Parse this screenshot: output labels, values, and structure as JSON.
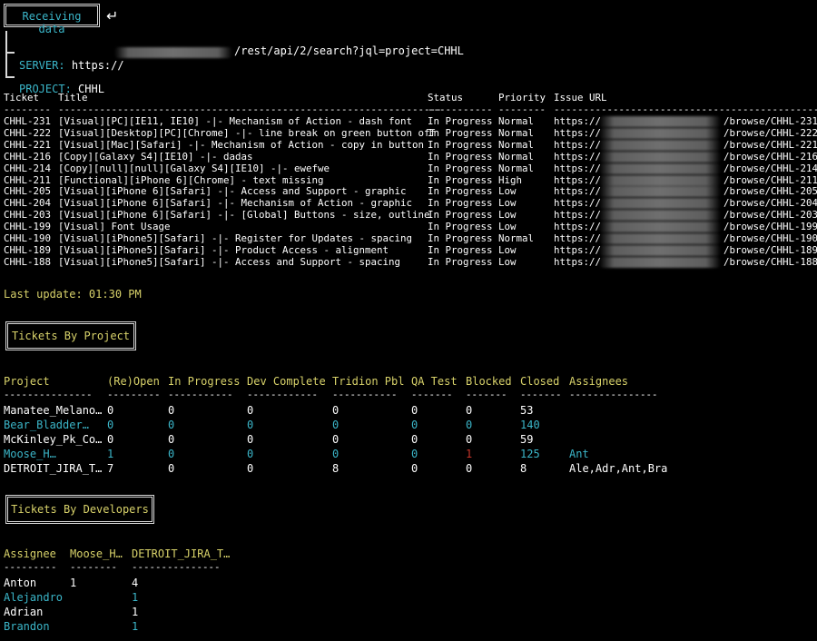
{
  "header": {
    "receiving_label": "Receiving data",
    "enter_glyph": "↵",
    "server_label": "SERVER:",
    "server_prefix": "https://",
    "server_suffix": "/rest/api/2/search?jql=project=CHHL",
    "project_label": "PROJECT:",
    "project_value": "CHHL"
  },
  "tickets_table": {
    "headers": [
      "Ticket",
      "Title",
      "Status",
      "Priority",
      "Issue URL"
    ],
    "url_prefix": "https://",
    "rows": [
      {
        "ticket": "CHHL-231",
        "title": "[Visual][PC][IE11, IE10] -|- Mechanism of Action - dash font",
        "status": "In Progress",
        "priority": "Normal",
        "url_suffix": "/browse/CHHL-231"
      },
      {
        "ticket": "CHHL-222",
        "title": "[Visual][Desktop][PC][Chrome] -|- line break on green button off",
        "status": "In Progress",
        "priority": "Normal",
        "url_suffix": "/browse/CHHL-222"
      },
      {
        "ticket": "CHHL-221",
        "title": "[Visual][Mac][Safari] -|- Mechanism of Action - copy in button",
        "status": "In Progress",
        "priority": "Normal",
        "url_suffix": "/browse/CHHL-221"
      },
      {
        "ticket": "CHHL-216",
        "title": "[Copy][Galaxy S4][IE10] -|- dadas",
        "status": "In Progress",
        "priority": "Normal",
        "url_suffix": "/browse/CHHL-216"
      },
      {
        "ticket": "CHHL-214",
        "title": "[Copy][null][null][Galaxy S4][IE10] -|- ewefwe",
        "status": "In Progress",
        "priority": "Normal",
        "url_suffix": "/browse/CHHL-214"
      },
      {
        "ticket": "CHHL-211",
        "title": "[Functional][iPhone 6][Chrome] - text missing",
        "status": "In Progress",
        "priority": "High",
        "url_suffix": "/browse/CHHL-211"
      },
      {
        "ticket": "CHHL-205",
        "title": "[Visual][iPhone 6][Safari] -|- Access and Support - graphic",
        "status": "In Progress",
        "priority": "Low",
        "url_suffix": "/browse/CHHL-205"
      },
      {
        "ticket": "CHHL-204",
        "title": "[Visual][iPhone 6][Safari] -|- Mechanism of Action - graphic",
        "status": "In Progress",
        "priority": "Low",
        "url_suffix": "/browse/CHHL-204"
      },
      {
        "ticket": "CHHL-203",
        "title": "[Visual][iPhone 6][Safari] -|- [Global] Buttons - size, outline",
        "status": "In Progress",
        "priority": "Low",
        "url_suffix": "/browse/CHHL-203"
      },
      {
        "ticket": "CHHL-199",
        "title": "[Visual] Font Usage",
        "status": "In Progress",
        "priority": "Low",
        "url_suffix": "/browse/CHHL-199"
      },
      {
        "ticket": "CHHL-190",
        "title": "[Visual][iPhone5][Safari] -|- Register for Updates - spacing",
        "status": "In Progress",
        "priority": "Normal",
        "url_suffix": "/browse/CHHL-190"
      },
      {
        "ticket": "CHHL-189",
        "title": "[Visual][iPhone5][Safari] -|- Product Access - alignment",
        "status": "In Progress",
        "priority": "Low",
        "url_suffix": "/browse/CHHL-189"
      },
      {
        "ticket": "CHHL-188",
        "title": "[Visual][iPhone5][Safari] -|- Access and Support - spacing",
        "status": "In Progress",
        "priority": "Low",
        "url_suffix": "/browse/CHHL-188"
      }
    ]
  },
  "last_update": "Last update: 01:30 PM",
  "by_project": {
    "section_title": "Tickets By Project",
    "headers": [
      "Project",
      "(Re)Open",
      "In Progress",
      "Dev Complete",
      "Tridion Pbl",
      "QA Test",
      "Blocked",
      "Closed",
      "Assignees"
    ],
    "rows": [
      {
        "color": "white",
        "cells": [
          "Manatee_Melano…",
          "0",
          "0",
          "0",
          "0",
          "0",
          "0",
          "53",
          ""
        ]
      },
      {
        "color": "cyan",
        "cells": [
          "Bear_Bladder…",
          "0",
          "0",
          "0",
          "0",
          "0",
          "0",
          "140",
          ""
        ]
      },
      {
        "color": "white",
        "cells": [
          "McKinley_Pk_Co…",
          "0",
          "0",
          "0",
          "0",
          "0",
          "0",
          "59",
          ""
        ]
      },
      {
        "color": "cyan",
        "cells": [
          "Moose_H…",
          "1",
          "0",
          "0",
          "0",
          "0",
          "1",
          "125",
          "Ant"
        ]
      },
      {
        "color": "white",
        "cells": [
          "DETROIT_JIRA_T…",
          "7",
          "0",
          "0",
          "8",
          "0",
          "0",
          "8",
          "Ale,Adr,Ant,Bra"
        ]
      }
    ]
  },
  "by_developer": {
    "section_title": "Tickets By Developers",
    "headers": [
      "Assignee",
      "Moose_H…",
      "DETROIT_JIRA_T…"
    ],
    "rows": [
      {
        "color": "white",
        "cells": [
          "Anton",
          "1",
          "4"
        ]
      },
      {
        "color": "cyan",
        "cells": [
          "Alejandro",
          "",
          "1"
        ]
      },
      {
        "color": "white",
        "cells": [
          "Adrian",
          "",
          "1"
        ]
      },
      {
        "color": "cyan",
        "cells": [
          "Brandon",
          "",
          "1"
        ]
      }
    ]
  },
  "colors": {
    "cyan": "#3bb6c9",
    "yellow": "#d8d26a",
    "red": "#c8352a",
    "white": "#ffffff"
  }
}
